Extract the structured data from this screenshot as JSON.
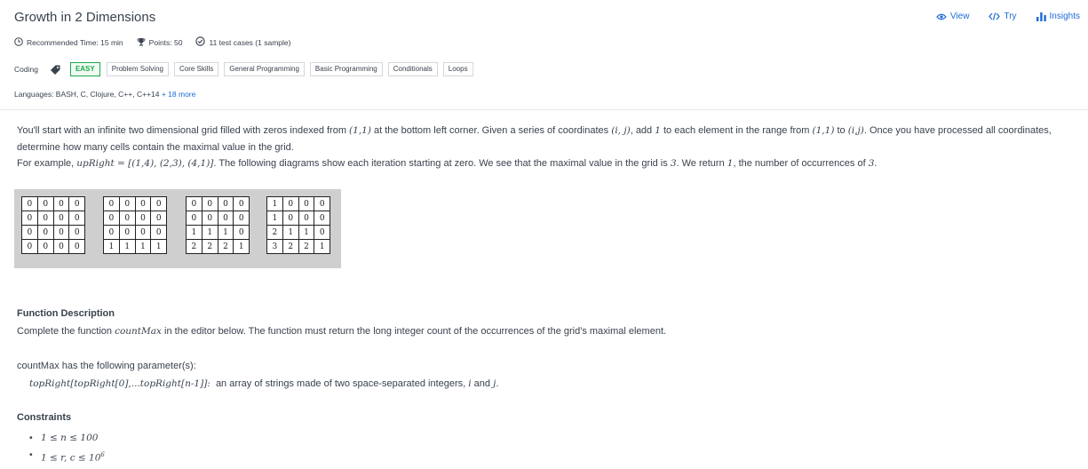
{
  "header": {
    "title": "Growth in 2 Dimensions",
    "actions": [
      {
        "label": "View",
        "icon": "eye-icon"
      },
      {
        "label": "Try",
        "icon": "code-icon"
      },
      {
        "label": "Insights",
        "icon": "bar-chart-icon"
      }
    ]
  },
  "meta": {
    "time": "Recommended Time: 15 min",
    "points": "Points: 50",
    "tests": "11 test cases (1 sample)"
  },
  "tags": {
    "category": "Coding",
    "difficulty": "EASY",
    "items": [
      "Problem Solving",
      "Core Skills",
      "General Programming",
      "Basic Programming",
      "Conditionals",
      "Loops"
    ]
  },
  "languages": {
    "text": "Languages: BASH, C, Clojure, C++, C++14",
    "more": "+ 18 more"
  },
  "description": {
    "p1_a": "You'll start with an infinite two dimensional grid filled with zeros indexed from ",
    "p1_b": "(1,1)",
    "p1_c": " at the bottom left corner. Given a series of coordinates ",
    "p1_d": "(i, j)",
    "p1_e": ", add ",
    "p1_f": "1",
    "p1_g": " to each element in the range from ",
    "p1_h": "(1,1)",
    "p1_i": " to ",
    "p1_j": "(i,j)",
    "p1_k": ". Once you have processed all coordinates, determine how many cells contain the maximal value in the grid.",
    "p2_a": "For example, ",
    "p2_b": "upRight = [(1,4), (2,3), (4,1)]",
    "p2_c": ". The following diagrams show each iteration starting at zero. We see that the maximal value in the grid is ",
    "p2_d": "3",
    "p2_e": ". We return ",
    "p2_f": "1",
    "p2_g": ", the number of occurrences of ",
    "p2_h": "3",
    "p2_i": "."
  },
  "grids": [
    [
      [
        "0",
        "0",
        "0",
        "0"
      ],
      [
        "0",
        "0",
        "0",
        "0"
      ],
      [
        "0",
        "0",
        "0",
        "0"
      ],
      [
        "0",
        "0",
        "0",
        "0"
      ]
    ],
    [
      [
        "0",
        "0",
        "0",
        "0"
      ],
      [
        "0",
        "0",
        "0",
        "0"
      ],
      [
        "0",
        "0",
        "0",
        "0"
      ],
      [
        "1",
        "1",
        "1",
        "1"
      ]
    ],
    [
      [
        "0",
        "0",
        "0",
        "0"
      ],
      [
        "0",
        "0",
        "0",
        "0"
      ],
      [
        "1",
        "1",
        "1",
        "0"
      ],
      [
        "2",
        "2",
        "2",
        "1"
      ]
    ],
    [
      [
        "1",
        "0",
        "0",
        "0"
      ],
      [
        "1",
        "0",
        "0",
        "0"
      ],
      [
        "2",
        "1",
        "1",
        "0"
      ],
      [
        "3",
        "2",
        "2",
        "1"
      ]
    ]
  ],
  "function_description": {
    "title": "Function Description",
    "text_a": "Complete the function ",
    "text_b": "countMax",
    "text_c": " in the editor below. The function must return the long integer count of the occurrences of the grid's maximal element."
  },
  "parameters": {
    "intro": "countMax has the following parameter(s):",
    "param_name": "topRight[topRight[0],...topRight[n-1]]:",
    "param_desc_a": "  an array of strings made of two space-separated integers, ",
    "param_i": "i",
    "param_and": " and ",
    "param_j": "j",
    "param_end": "."
  },
  "constraints": {
    "title": "Constraints",
    "c1": "1 ≤ n ≤ 100",
    "c2_base": "1 ≤ r, c ≤ 10",
    "c2_exp": "6"
  },
  "colors": {
    "accent": "#1f6bd6",
    "easy": "#1ba94c",
    "text": "#39424e"
  }
}
